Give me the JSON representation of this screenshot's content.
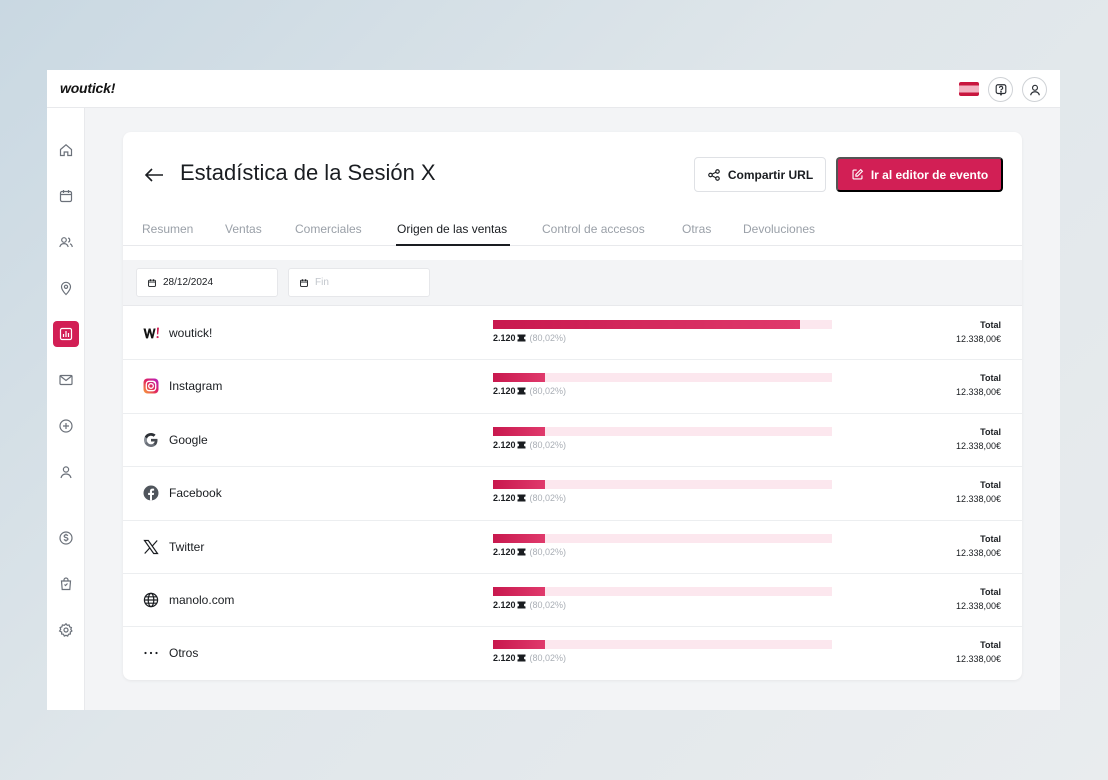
{
  "app": {
    "logo": "woutick!"
  },
  "page": {
    "title": "Estadística de la Sesión X"
  },
  "actions": {
    "share_label": "Compartir URL",
    "edit_label": "Ir al editor de evento"
  },
  "tabs": [
    {
      "label": "Resumen",
      "active": false
    },
    {
      "label": "Ventas",
      "active": false
    },
    {
      "label": "Comerciales",
      "active": false
    },
    {
      "label": "Origen de las ventas",
      "active": true
    },
    {
      "label": "Control de accesos",
      "active": false
    },
    {
      "label": "Otras",
      "active": false
    },
    {
      "label": "Devoluciones",
      "active": false
    }
  ],
  "filters": {
    "start_date": "28/12/2024",
    "end_placeholder": "Fin"
  },
  "sources": [
    {
      "name": "woutick!",
      "icon": "woutick-logo-icon",
      "count": "2.120",
      "percent": "(80,02%)",
      "bar_fraction": 0.905,
      "total_label": "Total",
      "total_value": "12.338,00€"
    },
    {
      "name": "Instagram",
      "icon": "instagram-icon",
      "count": "2.120",
      "percent": "(80,02%)",
      "bar_fraction": 0.153,
      "total_label": "Total",
      "total_value": "12.338,00€"
    },
    {
      "name": "Google",
      "icon": "google-icon",
      "count": "2.120",
      "percent": "(80,02%)",
      "bar_fraction": 0.153,
      "total_label": "Total",
      "total_value": "12.338,00€"
    },
    {
      "name": "Facebook",
      "icon": "facebook-icon",
      "count": "2.120",
      "percent": "(80,02%)",
      "bar_fraction": 0.153,
      "total_label": "Total",
      "total_value": "12.338,00€"
    },
    {
      "name": "Twitter",
      "icon": "x-twitter-icon",
      "count": "2.120",
      "percent": "(80,02%)",
      "bar_fraction": 0.153,
      "total_label": "Total",
      "total_value": "12.338,00€"
    },
    {
      "name": "manolo.com",
      "icon": "globe-icon",
      "count": "2.120",
      "percent": "(80,02%)",
      "bar_fraction": 0.153,
      "total_label": "Total",
      "total_value": "12.338,00€"
    },
    {
      "name": "Otros",
      "icon": "more-dots-icon",
      "count": "2.120",
      "percent": "(80,02%)",
      "bar_fraction": 0.153,
      "total_label": "Total",
      "total_value": "12.338,00€"
    }
  ],
  "colors": {
    "accent": "#d21f55",
    "bar_track": "#fce7ee"
  }
}
